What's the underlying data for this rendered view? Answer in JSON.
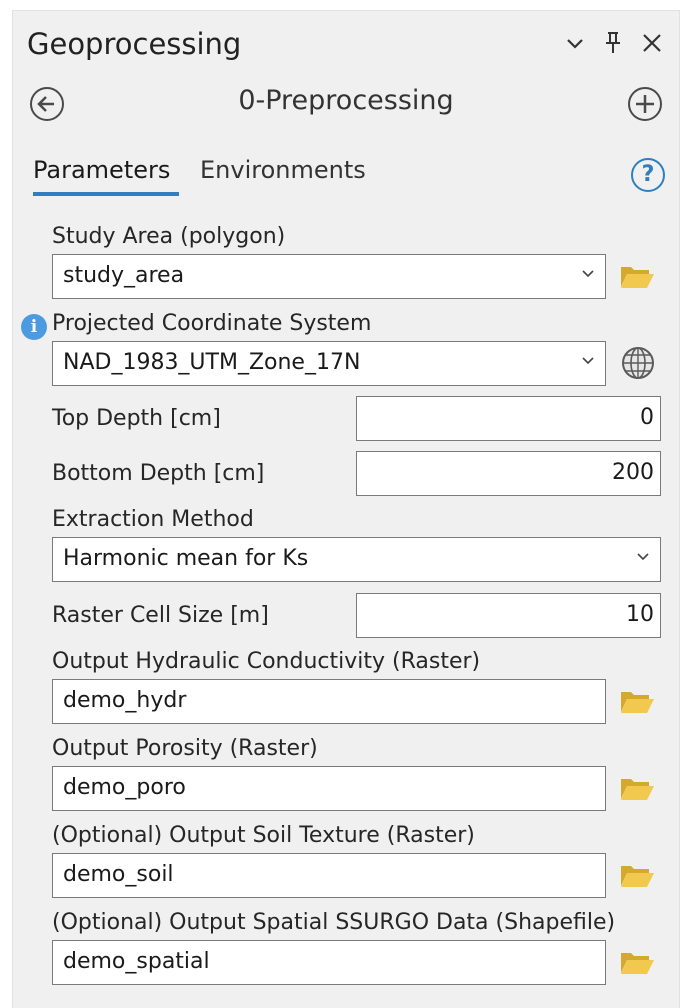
{
  "header": {
    "title": "Geoprocessing",
    "tool_name": "0-Preprocessing"
  },
  "tabs": {
    "parameters": "Parameters",
    "environments": "Environments",
    "help_symbol": "?"
  },
  "fields": {
    "study_area": {
      "label": "Study Area (polygon)",
      "value": "study_area"
    },
    "coord_system": {
      "label": "Projected Coordinate System",
      "value": "NAD_1983_UTM_Zone_17N"
    },
    "top_depth": {
      "label": "Top Depth [cm]",
      "value": "0"
    },
    "bottom_depth": {
      "label": "Bottom Depth [cm]",
      "value": "200"
    },
    "extraction_method": {
      "label": "Extraction Method",
      "value": "Harmonic mean for Ks"
    },
    "cell_size": {
      "label": "Raster Cell Size [m]",
      "value": "10"
    },
    "out_hydr": {
      "label": "Output Hydraulic Conductivity (Raster)",
      "value": "demo_hydr"
    },
    "out_poro": {
      "label": "Output Porosity (Raster)",
      "value": "demo_poro"
    },
    "out_soil": {
      "label": "(Optional) Output Soil Texture (Raster)",
      "value": "demo_soil"
    },
    "out_spatial": {
      "label": "(Optional) Output Spatial SSURGO Data (Shapefile)",
      "value": "demo_spatial"
    }
  },
  "info_symbol": "i",
  "colors": {
    "accent": "#2e7ec0",
    "folder": "#e8c24a",
    "info": "#4c9be0"
  }
}
